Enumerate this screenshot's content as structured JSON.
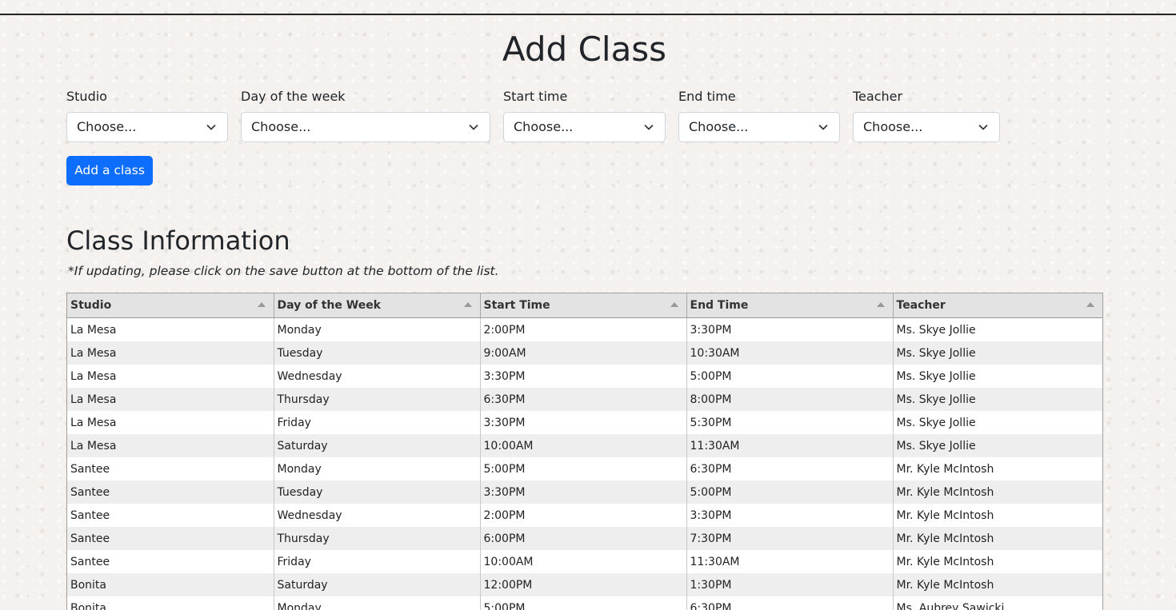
{
  "page": {
    "title": "Add Class"
  },
  "form": {
    "fields": [
      {
        "label": "Studio",
        "value": "Choose..."
      },
      {
        "label": "Day of the week",
        "value": "Choose..."
      },
      {
        "label": "Start time",
        "value": "Choose..."
      },
      {
        "label": "End time",
        "value": "Choose..."
      },
      {
        "label": "Teacher",
        "value": "Choose..."
      }
    ],
    "add_button_label": "Add a class"
  },
  "class_info": {
    "title": "Class Information",
    "note": "*If updating, please click on the save button at the bottom of the list.",
    "columns": [
      "Studio",
      "Day of the Week",
      "Start Time",
      "End Time",
      "Teacher"
    ],
    "rows": [
      [
        "La Mesa",
        "Monday",
        "2:00PM",
        "3:30PM",
        "Ms. Skye Jollie"
      ],
      [
        "La Mesa",
        "Tuesday",
        "9:00AM",
        "10:30AM",
        "Ms. Skye Jollie"
      ],
      [
        "La Mesa",
        "Wednesday",
        "3:30PM",
        "5:00PM",
        "Ms. Skye Jollie"
      ],
      [
        "La Mesa",
        "Thursday",
        "6:30PM",
        "8:00PM",
        "Ms. Skye Jollie"
      ],
      [
        "La Mesa",
        "Friday",
        "3:30PM",
        "5:30PM",
        "Ms. Skye Jollie"
      ],
      [
        "La Mesa",
        "Saturday",
        "10:00AM",
        "11:30AM",
        "Ms. Skye Jollie"
      ],
      [
        "Santee",
        "Monday",
        "5:00PM",
        "6:30PM",
        "Mr. Kyle McIntosh"
      ],
      [
        "Santee",
        "Tuesday",
        "3:30PM",
        "5:00PM",
        "Mr. Kyle McIntosh"
      ],
      [
        "Santee",
        "Wednesday",
        "2:00PM",
        "3:30PM",
        "Mr. Kyle McIntosh"
      ],
      [
        "Santee",
        "Thursday",
        "6:00PM",
        "7:30PM",
        "Mr. Kyle McIntosh"
      ],
      [
        "Santee",
        "Friday",
        "10:00AM",
        "11:30AM",
        "Mr. Kyle McIntosh"
      ],
      [
        "Bonita",
        "Saturday",
        "12:00PM",
        "1:30PM",
        "Mr. Kyle McIntosh"
      ],
      [
        "Bonita",
        "Monday",
        "5:00PM",
        "6:30PM",
        "Ms. Aubrey Sawicki"
      ]
    ]
  },
  "colors": {
    "primary_button": "#0d6efd",
    "page_background": "#f4f1ee",
    "table_header": "#e3e3e3",
    "row_stripe": "#eeeeee"
  },
  "icons": {
    "select_arrow": "chevron-down-icon",
    "sort_indicator": "sort-arrow-icon"
  }
}
